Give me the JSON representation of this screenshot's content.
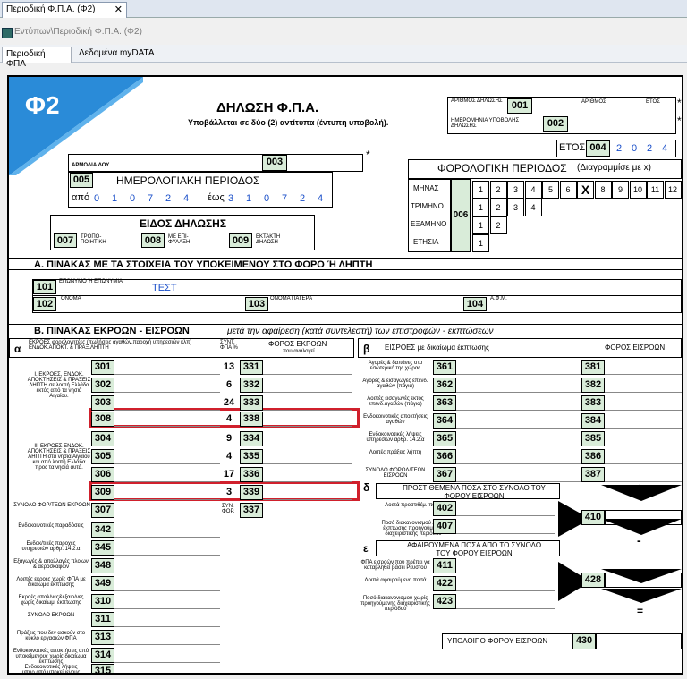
{
  "window": {
    "doc_tab": "Περιοδική Φ.Π.Α. (Φ2)",
    "close_glyph": "✕",
    "path": "Εντύπων\\Περιοδική Φ.Π.Α. (Φ2)"
  },
  "tabs": [
    "Περιοδική ΦΠΑ",
    "Δεδομένα myDATA"
  ],
  "form": {
    "logo": "Φ2",
    "taxis": "T A X I S",
    "title": "ΔΗΛΩΣΗ Φ.Π.Α.",
    "subtitle": "Υποβάλλεται σε δύο (2) αντίτυπα (έντυπη υποβολή).",
    "arithmos_dilosis": "ΑΡΙΘΜΟΣ ΔΗΛΩΣΗΣ",
    "arithmos": "ΑΡΙΘΜΟΣ",
    "etos_small": "ΕΤΟΣ",
    "imerominia": "ΗΜΕΡΟΜΗΝΙΑ ΥΠΟΒΟΛΗΣ ΔΗΛΩΣΗΣ",
    "star": "*",
    "etos": "ΕΤΟΣ",
    "year_digits": [
      "2",
      "0",
      "2",
      "4"
    ],
    "armodia_doy": "ΑΡΜΟΔΙΑ ΔΟΥ",
    "imerologiaki": "ΗΜΕΡΟΛΟΓΙΑΚΗ ΠΕΡΙΟΔΟΣ",
    "apo": "από",
    "eos": "έως",
    "from_digits": [
      "0",
      "1",
      "0",
      "7",
      "2",
      "4"
    ],
    "to_digits": [
      "3",
      "1",
      "0",
      "7",
      "2",
      "4"
    ],
    "forologiki": "ΦΟΡΟΛΟΓΙΚΗ ΠΕΡΙΟΔΟΣ",
    "forologiki_hint": "(Διαγραμμίσε με x)",
    "period_rows": [
      "ΜΗΝΑΣ",
      "ΤΡΙΜΗΝΟ",
      "ΕΞΑΜΗΝΟ",
      "ΕΤΗΣΙΑ"
    ],
    "months": [
      "1",
      "2",
      "3",
      "4",
      "5",
      "6",
      "X",
      "8",
      "9",
      "10",
      "11",
      "12"
    ],
    "quarters": [
      "1",
      "2",
      "3",
      "4"
    ],
    "halves": [
      "1",
      "2"
    ],
    "annual": [
      "1"
    ],
    "eidos": "ΕΙΔΟΣ ΔΗΛΩΣΗΣ",
    "eidos_items": [
      "ΤΡΟΠΟ-ΠΟΙΗΤΙΚΗ",
      "ΜΕ ΕΠΙ-ΦΥΛΑΞΗ",
      "ΕΚΤΑΚΤΗ ΔΗΛΩΣΗ"
    ],
    "section_a": "Α. ΠΙΝΑΚΑΣ ΜΕ ΤΑ ΣΤΟΙΧΕΙΑ ΤΟΥ ΥΠΟΚΕΙΜΕΝΟΥ ΣΤΟ ΦΟΡΟ Ή ΛΗΠΤΗ",
    "eponymo": "ΕΠΩΝΥΜΟ Ή ΕΠΩΝΥΜΙΑ",
    "eponymo_value": "ΤΕΣΤ",
    "onoma": "ΟΝΟΜΑ",
    "onoma_patera": "ΟΝΟΜΑ ΠΑΤΕΡΑ",
    "afm": "Α.Φ.Μ.",
    "section_b": "Β. ΠΙΝΑΚΑΣ ΕΚΡΟΩΝ - ΕΙΣΡΟΩΝ",
    "section_b_note": "μετά την αφαίρεση (κατά συντελεστή) των επιστροφών - εκπτώσεων",
    "alpha": "α",
    "beta": "β",
    "delta": "δ",
    "epsilon": "ε",
    "ekroes_hdr": "ΕΚΡΟΕΣ φορολογητέες (πωλήσεις αγαθών,παροχή υπηρεσιών κλπ) ΕΝΔΟΚ.ΑΠΟΚΤ. & ΠΡΑΞ.ΛΗΠΤΗ",
    "synt": "ΣΥΝΤ. ΦΠΑ %",
    "foros_ekroon": "ΦΟΡΟΣ ΕΚΡΟΩΝ",
    "pou_analogei": "που αναλογεί",
    "eisroes_hdr": "ΕΙΣΡΟΕΣ με δικαίωμα έκπτωσης",
    "foros_eisroon": "ΦΟΡΟΣ ΕΙΣΡΟΩΝ",
    "group1": "Ι. ΕΚΡΟΕΣ, ΕΝΔΟΚ. ΑΠΟΚΤΗΣΕΙΣ & ΠΡΑΞΕΙΣ ΛΗΠΤΗ σε λοιπή Ελλάδα εκτός από τα νησιά Αιγαίου.",
    "group2": "ΙΙ. ΕΚΡΟΕΣ ΕΝΔΟΚ. ΑΠΟΚΤΗΣΕΙΣ & ΠΡΑΞΕΙΣ ΛΗΠΤΗ στα νησιά Αιγαίου και από λοιπή Ελλάδα προς τα νησιά αυτά.",
    "rate_rows": [
      {
        "code": "301",
        "rate": "13",
        "tax": "331"
      },
      {
        "code": "302",
        "rate": "6",
        "tax": "332"
      },
      {
        "code": "303",
        "rate": "24",
        "tax": "333"
      },
      {
        "code": "308",
        "rate": "4",
        "tax": "338"
      },
      {
        "code": "304",
        "rate": "9",
        "tax": "334"
      },
      {
        "code": "305",
        "rate": "4",
        "tax": "335"
      },
      {
        "code": "306",
        "rate": "17",
        "tax": "336"
      },
      {
        "code": "309",
        "rate": "3",
        "tax": "339"
      }
    ],
    "synolo_ekroon_row": {
      "label": "ΣΥΝΟΛΟ ΦΟΡ/ΤΕΩΝ ΕΚΡΟΩΝ",
      "code": "307",
      "rate": "ΣΥΝ. ΦΟΡ.",
      "tax": "337"
    },
    "other_rows": [
      {
        "label": "Ενδοκοινοτικές παραδόσεις",
        "code": "342"
      },
      {
        "label": "Ενδοκ/τικές παροχές υπηρεσιών αρθρ. 14.2.α",
        "code": "345"
      },
      {
        "label": "Εξαγωγές & απαλλαγές πλοίων & αεροσκαφών",
        "code": "348"
      },
      {
        "label": "Λοιπές εκροές χωρίς ΦΠΑ με δικαίωμα έκπτωσης",
        "code": "349"
      },
      {
        "label": "Εκροές απαλ/νες&εξαιρ/νες χωρίς δικαίωμ. έκπτωσης",
        "code": "310"
      },
      {
        "label": "ΣΥΝΟΛΟ ΕΚΡΟΩΝ",
        "code": "311"
      },
      {
        "label": "Πράξεις που δεν ασκούν στο κύκλο εργασιών ΦΠΑ",
        "code": "313"
      },
      {
        "label": "Ενδοκοινοτικές αποκτήσεις από υποκείμενους χωρίς δικαίωμα έκπτωσης",
        "code": "314"
      },
      {
        "label": "Ενδοκοινοτικές λήψεις υπηρ.από υποκείμενους",
        "code": "315"
      }
    ],
    "eisroes_rows": [
      {
        "label": "Αγορές & δαπάνες στο εσωτερικό της χώρας",
        "code": "361",
        "tax": "381"
      },
      {
        "label": "Αγορές & εισαγωγές επενδ. αγαθών (πάγια)",
        "code": "362",
        "tax": "382"
      },
      {
        "label": "Λοιπές εισαγωγές εκτός επενδ.αγαθών (πάγια)",
        "code": "363",
        "tax": "383"
      },
      {
        "label": "Ενδοκοινοτικές αποκτήσεις αγαθών",
        "code": "364",
        "tax": "384"
      },
      {
        "label": "Ενδοκοινοτικές λήψεις υπηρεσιών αρθρ. 14.2.α",
        "code": "365",
        "tax": "385"
      },
      {
        "label": "Λοιπές πράξεις λήπτη",
        "code": "366",
        "tax": "386"
      },
      {
        "label": "ΣΥΝΟΛΟ ΦΟΡΟΛ/ΤΕΩΝ ΕΙΣΡΟΩΝ",
        "code": "367",
        "tax": "387"
      }
    ],
    "prostithemena": "ΠΡΟΣΤΙΘΕΜΕΝΑ ΠΟΣΑ ΣΤΟ ΣΥΝΟΛΟ ΤΟΥ ΦΟΡΟΥ ΕΙΣΡΟΩΝ",
    "add_rows": [
      {
        "label": "Λοιπά προστιθέμ. ποσά",
        "code": "402"
      },
      {
        "label": "Ποσό διακανονισμού λόγω έκπτωσης προηγούμενης διαχειριστικής περιόδου",
        "code": "407"
      }
    ],
    "afairoumena": "ΑΦΑΙΡΟΥΜΕΝΑ ΠΟΣΑ ΑΠΟ ΤΟ ΣΥΝΟΛΟ ΤΟΥ ΦΟΡΟΥ ΕΙΣΡΟΩΝ",
    "sub_rows": [
      {
        "label": "ΦΠΑ εισροών που πρέπει να καταβληθεί βάσει Ρευστού",
        "code": "411"
      },
      {
        "label": "Λοιπά αφαιρούμενα ποσά",
        "code": "422"
      },
      {
        "label": "Ποσό διακανονισμού χωρίς προηγούμενης διαχειριστικής περιόδου",
        "code": "423"
      }
    ],
    "box410": "410",
    "box428": "428",
    "plus": "+",
    "minus": "-",
    "equals": "=",
    "ypoloipo": "ΥΠΟΛΟΙΠΟ ΦΟΡΟΥ ΕΙΣΡΟΩΝ",
    "ypoloipo_code": "430",
    "codes": {
      "c001": "001",
      "c002": "002",
      "c003": "003",
      "c004": "004",
      "c005": "005",
      "c006": "006",
      "c007": "007",
      "c008": "008",
      "c009": "009",
      "c101": "101",
      "c102": "102",
      "c103": "103",
      "c104": "104"
    }
  }
}
